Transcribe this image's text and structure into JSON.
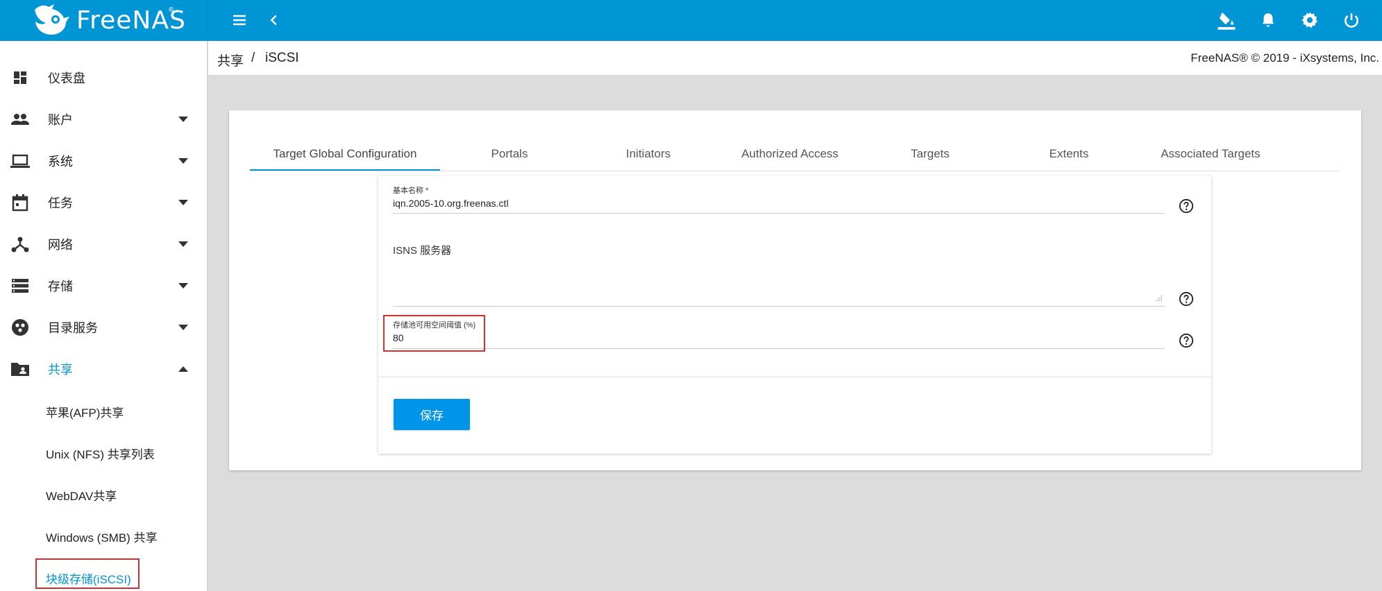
{
  "app": {
    "logo_text": "FreeNAS",
    "logo_reg": "®"
  },
  "topbar": {
    "icons": [
      "menu-icon",
      "back-chevron-icon",
      "paint-bucket-icon",
      "bell-icon",
      "gear-icon",
      "power-icon"
    ]
  },
  "sidebar": {
    "items": [
      {
        "label": "仪表盘",
        "icon": "dashboard-icon",
        "expandable": false
      },
      {
        "label": "账户",
        "icon": "people-icon",
        "expandable": true
      },
      {
        "label": "系统",
        "icon": "laptop-icon",
        "expandable": true
      },
      {
        "label": "任务",
        "icon": "calendar-icon",
        "expandable": true
      },
      {
        "label": "网络",
        "icon": "network-icon",
        "expandable": true
      },
      {
        "label": "存储",
        "icon": "storage-icon",
        "expandable": true
      },
      {
        "label": "目录服务",
        "icon": "directory-icon",
        "expandable": true
      },
      {
        "label": "共享",
        "icon": "shared-folder-icon",
        "expandable": true,
        "expanded": true
      }
    ],
    "sub_items": [
      {
        "label": "苹果(AFP)共享"
      },
      {
        "label": "Unix (NFS) 共享列表"
      },
      {
        "label": "WebDAV共享"
      },
      {
        "label": "Windows (SMB) 共享"
      },
      {
        "label": "块级存储(iSCSI)",
        "active": true
      }
    ]
  },
  "breadcrumb": {
    "parent": "共享",
    "separator": "/",
    "current": "iSCSI"
  },
  "copyright": "FreeNAS® © 2019 - iXsystems, Inc.",
  "tabs": [
    {
      "label": "Target Global Configuration",
      "active": true
    },
    {
      "label": "Portals"
    },
    {
      "label": "Initiators"
    },
    {
      "label": "Authorized Access"
    },
    {
      "label": "Targets"
    },
    {
      "label": "Extents"
    },
    {
      "label": "Associated Targets"
    }
  ],
  "form": {
    "basename": {
      "label": "基本名称 *",
      "value": "iqn.2005-10.org.freenas.ctl"
    },
    "isns": {
      "label": "ISNS 服务器",
      "value": ""
    },
    "pool_threshold": {
      "label": "存储池可用空间阈值 (%)",
      "value": "80"
    },
    "save_label": "保存"
  },
  "colors": {
    "brand": "#0095d5",
    "highlight": "#d32f2f",
    "button": "#0095e8"
  }
}
